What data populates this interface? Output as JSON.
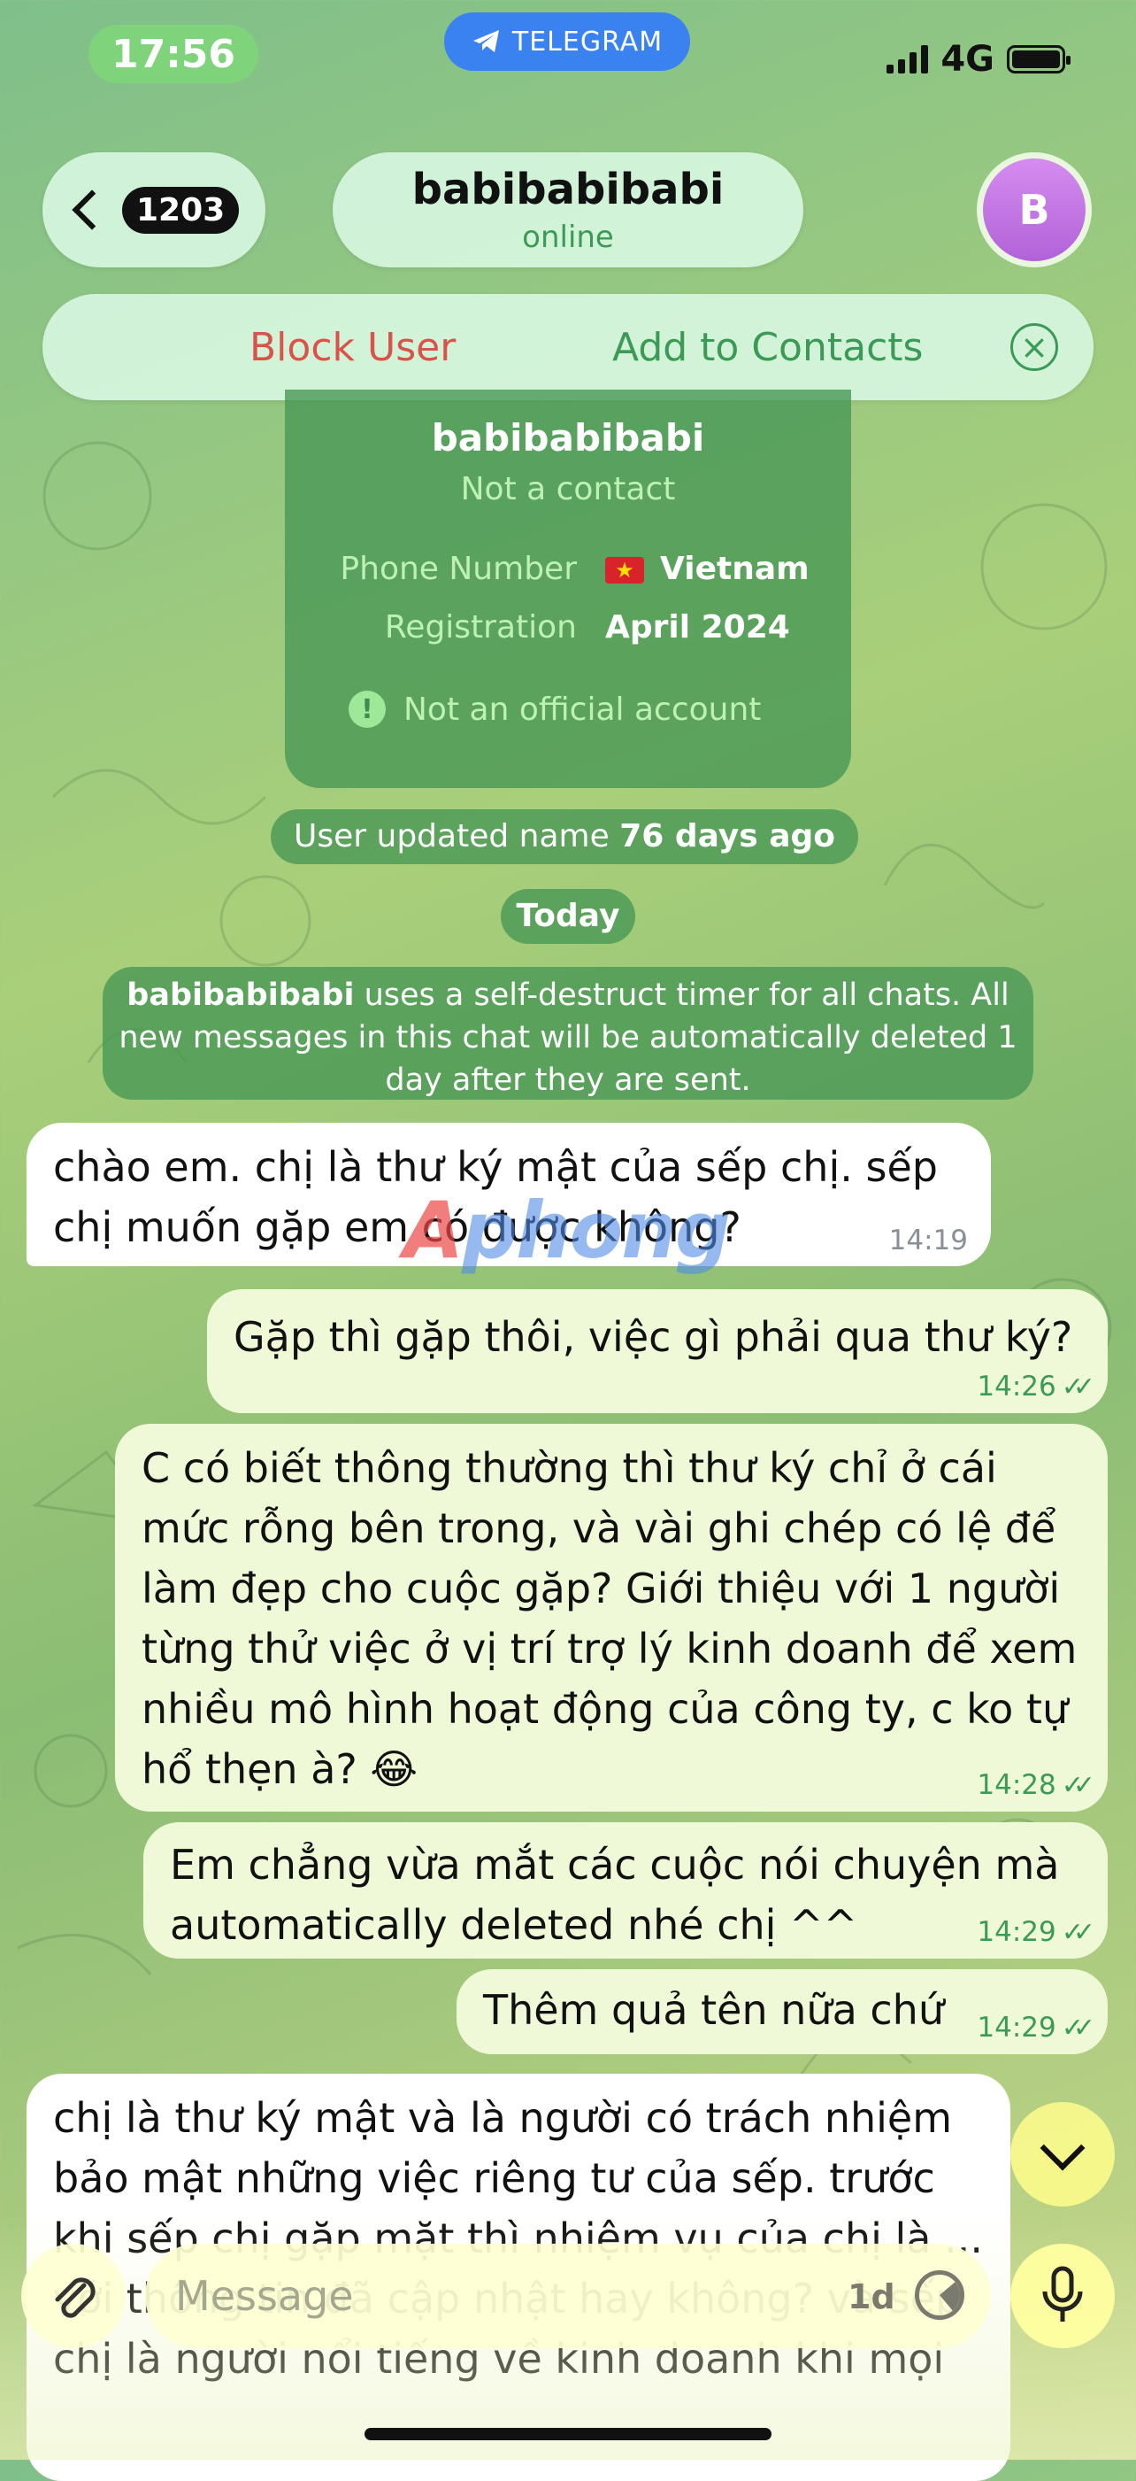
{
  "status_bar": {
    "time": "17:56",
    "app_badge": "TELEGRAM",
    "network": "4G",
    "icons": [
      "signal-icon",
      "battery-icon",
      "telegram-icon"
    ]
  },
  "header": {
    "back_count": "1203",
    "chat_name": "babibabibabi",
    "chat_status": "online",
    "avatar_letter": "B",
    "avatar_color": "#c779e6"
  },
  "action_bar": {
    "block_label": "Block User",
    "add_label": "Add to Contacts",
    "block_color": "#d9534a",
    "add_color": "#3b9a55"
  },
  "info_card": {
    "name": "babibabibabi",
    "subtitle": "Not a contact",
    "phone_label": "Phone Number",
    "phone_value": "Vietnam",
    "registration_label": "Registration",
    "registration_value": "April 2024",
    "warning": "Not an official account"
  },
  "service_messages": {
    "name_update_prefix": "User updated name ",
    "name_update_bold": "76 days ago",
    "date_divider": "Today",
    "timer_bold": "babibabibabi",
    "timer_text": " uses a self-destruct timer for all chats. All new messages in this chat will be automatically deleted 1 day after they are sent."
  },
  "messages": [
    {
      "direction": "incoming",
      "text": "chào em. chị là thư ký mật của sếp chị. sếp chị muốn gặp em có được không?",
      "time": "14:19"
    },
    {
      "direction": "outgoing",
      "text": "Gặp thì gặp thôi, việc gì phải qua thư ký?",
      "time": "14:26",
      "read": true
    },
    {
      "direction": "outgoing",
      "text": "C có biết thông thường thì thư ký chỉ ở cái mức rỗng bên trong, và vài ghi chép có lệ để làm đẹp cho cuộc gặp? Giới thiệu với 1 người từng thử việc ở vị trí trợ lý kinh doanh để xem nhiều mô hình hoạt động của công ty, c ko tự hổ thẹn à? 😂",
      "time": "14:28",
      "read": true
    },
    {
      "direction": "outgoing",
      "text": "Em chẳng vừa mắt các cuộc nói chuyện mà automatically deleted nhé chị ^^",
      "time": "14:29",
      "read": true
    },
    {
      "direction": "outgoing",
      "text": "Thêm quả tên nữa chứ",
      "time": "14:29",
      "read": true
    },
    {
      "direction": "incoming",
      "text": "chị là thư ký mật và là người có trách nhiệm bảo mật những việc riêng tư của sếp. trước khi sếp chị gặp mặt thì nhiệm vụ của chị là ... với thông tin đã cập nhật hay không? và sếp chị là người nổi tiếng về kinh doanh khi mọi",
      "time": ""
    }
  ],
  "watermark": {
    "part1": "A",
    "part2": "phong"
  },
  "composer": {
    "placeholder": "Message",
    "timer_label": "1d"
  }
}
